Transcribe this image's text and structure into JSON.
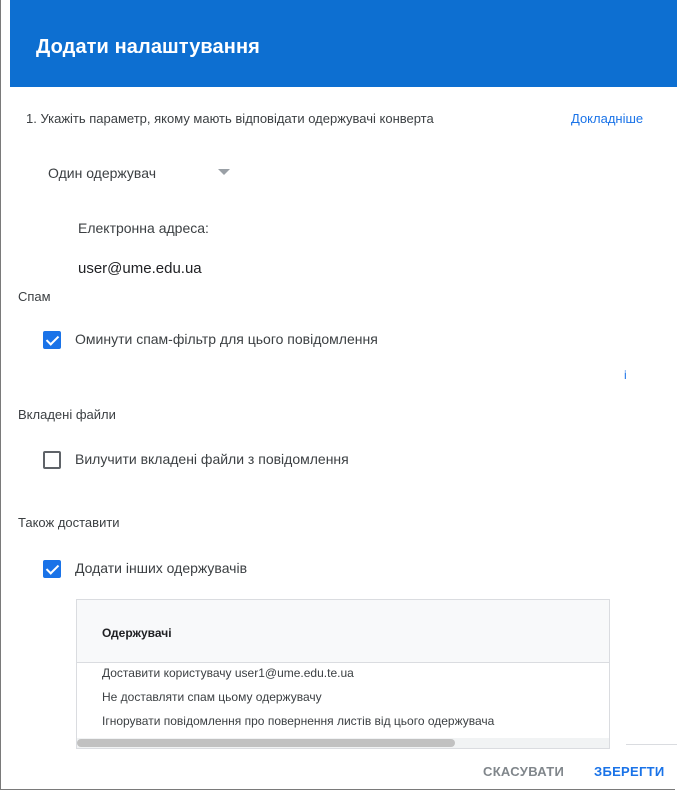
{
  "dialog": {
    "title": "Додати налаштування",
    "step1": {
      "label": "1. Укажіть параметр, якому мають відповідати одержувачі конверта",
      "learn_more": "Докладніше",
      "select_value": "Один одержувач",
      "email_label": "Електронна адреса:",
      "email_value": "user@ume.edu.ua"
    },
    "spam": {
      "heading": "Спам",
      "checkbox_label": "Оминути спам-фільтр для цього повідомлення",
      "checked": true,
      "info_glyph": "i"
    },
    "attachments": {
      "heading": "Вкладені файли",
      "checkbox_label": "Вилучити вкладені файли з повідомлення",
      "checked": false
    },
    "also_deliver": {
      "heading": "Також доставити",
      "checkbox_label": "Додати інших одержувачів",
      "checked": true,
      "table": {
        "header": "Одержувачі",
        "rows": [
          "Доставити користувачу user1@ume.edu.te.ua",
          "Не доставляти спам цьому одержувачу",
          "Ігнорувати повідомлення про повернення листів від цього одержувача"
        ]
      }
    },
    "footer": {
      "cancel": "СКАСУВАТИ",
      "save": "ЗБЕРЕГТИ"
    }
  },
  "colors": {
    "header_bg": "#0d6fd1",
    "accent": "#1a73e8"
  }
}
